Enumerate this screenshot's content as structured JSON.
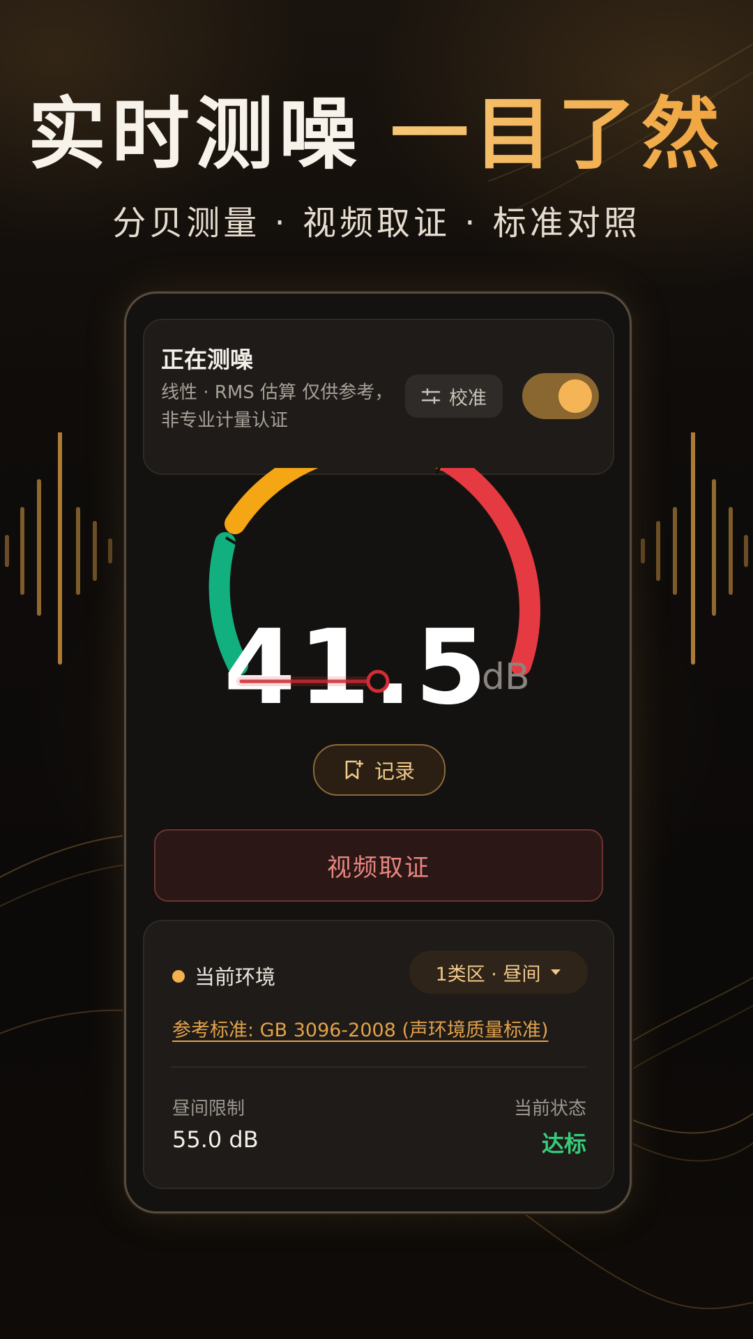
{
  "headline": {
    "part1": "实时测噪",
    "part2": "一目了然"
  },
  "subline": "分贝测量 · 视频取证 · 标准对照",
  "status": {
    "title": "正在测噪",
    "subtitle": "线性 · RMS 估算 仅供参考，非专业计量认证",
    "calibrate_label": "校准",
    "toggle_on": true
  },
  "meter": {
    "value": "41.5",
    "unit": "dB",
    "record_label": "记录"
  },
  "video_button_label": "视频取证",
  "environment": {
    "label": "当前环境",
    "zone": "1类区 · 昼间",
    "standard_link": "参考标准: GB 3096-2008 (声环境质量标准)",
    "limit_label": "昼间限制",
    "limit_value": "55.0 dB",
    "state_label": "当前状态",
    "state_value": "达标"
  },
  "colors": {
    "accent": "#f3b04f",
    "gauge_green": "#12b07f",
    "gauge_amber": "#f5a614",
    "gauge_orange": "#f47b12",
    "gauge_red": "#e63a42",
    "status_ok": "#36cc7a",
    "video_red": "#e8857e"
  }
}
